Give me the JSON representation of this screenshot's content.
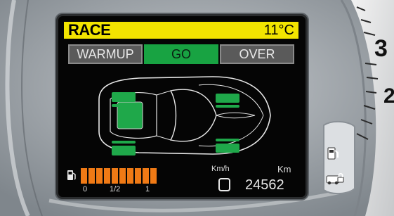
{
  "display": {
    "mode": "RACE",
    "temperature": "11°C",
    "tabs": [
      {
        "label": "WARMUP",
        "active": false
      },
      {
        "label": "GO",
        "active": true
      },
      {
        "label": "OVER",
        "active": false
      }
    ]
  },
  "tires": {
    "status_color": "#1fa84a",
    "front_left": "green",
    "front_right": "green",
    "rear_left": "green",
    "rear_right": "green"
  },
  "fuel": {
    "scale_labels": [
      "0",
      "1/2",
      "1"
    ],
    "level_fraction": 1.0,
    "bar_count": 10,
    "bar_color": "#f07a15"
  },
  "speed_unit": "Km/h",
  "odometer": {
    "unit": "Km",
    "value": "24562"
  },
  "gauge": {
    "tick_numbers": [
      "3",
      "2"
    ]
  },
  "icons": {
    "fuel_left": "fuel-pump-icon",
    "fuel_right": "fuel-pump-icon",
    "lock": "car-lock-icon",
    "trip": "square-trip-icon"
  }
}
